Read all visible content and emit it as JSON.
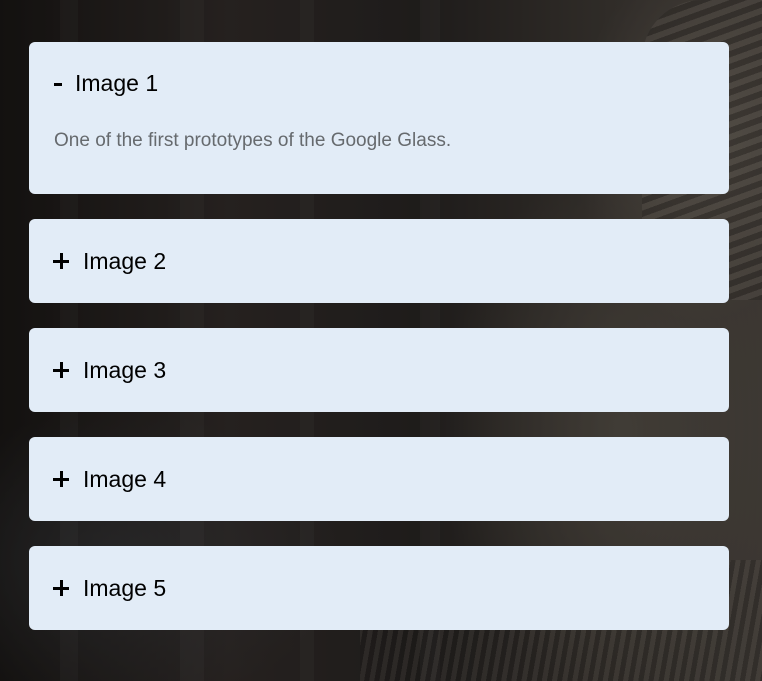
{
  "accordion": {
    "items": [
      {
        "title": "Image 1",
        "expanded": true,
        "toggle_symbol": "-",
        "toggle_icon": "minus-icon",
        "body": "One of the first prototypes of the Google Glass."
      },
      {
        "title": "Image 2",
        "expanded": false,
        "toggle_icon": "plus-icon"
      },
      {
        "title": "Image 3",
        "expanded": false,
        "toggle_icon": "plus-icon"
      },
      {
        "title": "Image 4",
        "expanded": false,
        "toggle_icon": "plus-icon"
      },
      {
        "title": "Image 5",
        "expanded": false,
        "toggle_icon": "plus-icon"
      }
    ]
  },
  "colors": {
    "panel_bg": "#e2ecf7",
    "title_text": "#000000",
    "body_text": "#666a6e"
  }
}
